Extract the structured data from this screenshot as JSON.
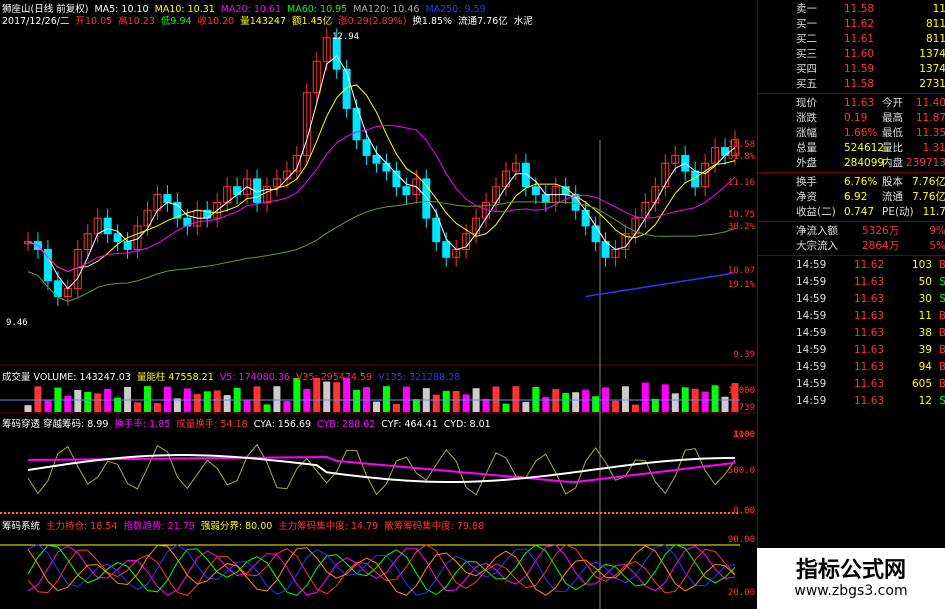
{
  "colors": {
    "up": "#ff3333",
    "down": "#00e5ff",
    "bg": "#000000",
    "grid": "#7a0000",
    "white": "#ffffff",
    "yellow": "#ffff00",
    "green": "#00ff00",
    "magenta": "#ff00ff",
    "purple": "#aa66ff",
    "olive": "#88aa44",
    "blue": "#3333ff"
  },
  "header": {
    "line1": [
      {
        "text": "狮座山(日线 前复权)",
        "color": "#ffffff"
      },
      {
        "text": "MA5: 10.10",
        "color": "#ffffff"
      },
      {
        "text": "MA10: 10.31",
        "color": "#ffff00"
      },
      {
        "text": "MA20: 10.61",
        "color": "#ff00ff"
      },
      {
        "text": "MA60: 10.95",
        "color": "#00ff00"
      },
      {
        "text": "MA120: 10.46",
        "color": "#aaaaaa"
      },
      {
        "text": "MA250: 9.59",
        "color": "#3333ff"
      }
    ],
    "line2": [
      {
        "text": "2017/12/26/二",
        "color": "#ffffff"
      },
      {
        "text": "开10.05",
        "color": "#ff3333"
      },
      {
        "text": "高10.23",
        "color": "#ff3333"
      },
      {
        "text": "低9.94",
        "color": "#00ff00"
      },
      {
        "text": "收10.20",
        "color": "#ff3333"
      },
      {
        "text": "量143247",
        "color": "#ffff00"
      },
      {
        "text": "额1.45亿",
        "color": "#ffff00"
      },
      {
        "text": "涨0.29(2.89%)",
        "color": "#ff3333"
      },
      {
        "text": "换1.85%",
        "color": "#ffffff"
      },
      {
        "text": "流通7.76亿",
        "color": "#ffffff"
      },
      {
        "text": "水泥",
        "color": "#ffffff"
      }
    ]
  },
  "price_axis": [
    "11.58",
    "61.8%",
    "11.16",
    "10.75",
    "38.2%",
    "10.07",
    "19.1%",
    "9.39"
  ],
  "price_annotations": {
    "high": "12.94",
    "low": "9.46"
  },
  "volume_header": [
    {
      "text": "成交量 VOLUME: 143247.03",
      "color": "#ffffff"
    },
    {
      "text": "量能柱 47558.21",
      "color": "#ffff00"
    },
    {
      "text": "V5: 174080.36",
      "color": "#ff00ff"
    },
    {
      "text": "V35: 295474.59",
      "color": "#ff3333"
    },
    {
      "text": "V135: 321288.28",
      "color": "#3333ff"
    }
  ],
  "volume_axis": [
    "10000",
    "4739",
    "X100"
  ],
  "ind1_header": [
    {
      "text": "筹码穿透 穿越筹码: 8.99",
      "color": "#ffffff"
    },
    {
      "text": "换手率: 1.85",
      "color": "#ff00ff"
    },
    {
      "text": "成量换手: 54.18",
      "color": "#ff3333"
    },
    {
      "text": "CYA: 156.69",
      "color": "#ffffff"
    },
    {
      "text": "CYB: 288.62",
      "color": "#ff00ff"
    },
    {
      "text": "CYF: 464.41",
      "color": "#ffffff"
    },
    {
      "text": "CYD: 8.01",
      "color": "#ffffff"
    }
  ],
  "ind1_axis": [
    "1000",
    "500.0",
    "0.00"
  ],
  "ind2_header": [
    {
      "text": "筹码系统",
      "color": "#ffffff"
    },
    {
      "text": "主力持仓: 18.54",
      "color": "#ff3333"
    },
    {
      "text": "指数趋势: 21.79",
      "color": "#ff00ff"
    },
    {
      "text": "强弱分界: 80.00",
      "color": "#ffff00"
    },
    {
      "text": "主力筹码集中度: 14.79",
      "color": "#ff3333"
    },
    {
      "text": "散筹筹码集中度: 79.88",
      "color": "#ff3333"
    }
  ],
  "ind2_axis": [
    "90.00",
    "20.00"
  ],
  "order_book": [
    {
      "label": "卖一",
      "price": "11.58",
      "vol": "11"
    },
    {
      "label": "买一",
      "price": "11.62",
      "vol": "811"
    },
    {
      "label": "买二",
      "price": "11.61",
      "vol": "811"
    },
    {
      "label": "买三",
      "price": "11.60",
      "vol": "1374"
    },
    {
      "label": "买四",
      "price": "11.59",
      "vol": "1374"
    },
    {
      "label": "买五",
      "price": "11.58",
      "vol": "2731"
    }
  ],
  "quote": [
    {
      "l1": "现价",
      "v1": "11.63",
      "l2": "今开",
      "v2": "11.40"
    },
    {
      "l1": "涨跌",
      "v1": "0.19",
      "l2": "最高",
      "v2": "11.87"
    },
    {
      "l1": "涨幅",
      "v1": "1.66%",
      "l2": "最低",
      "v2": "11.35"
    },
    {
      "l1": "总量",
      "v1": "524612",
      "l2": "量比",
      "v2": "1.31"
    },
    {
      "l1": "外盘",
      "v1": "284099",
      "l2": "内盘",
      "v2": "239713"
    }
  ],
  "quote2": [
    {
      "l1": "换手",
      "v1": "6.76%",
      "l2": "股本",
      "v2": "7.76亿"
    },
    {
      "l1": "净资",
      "v1": "6.92",
      "l2": "流通",
      "v2": "7.76亿"
    },
    {
      "l1": "收益(二)",
      "v1": "0.747",
      "l2": "PE(动)",
      "v2": "11.7"
    }
  ],
  "flow": [
    {
      "label": "净流入额",
      "value": "5326万",
      "pct": "9%"
    },
    {
      "label": "大宗流入",
      "value": "2864万",
      "pct": "5%"
    }
  ],
  "ticks": [
    {
      "time": "14:59",
      "price": "11.62",
      "vol": "103",
      "bs": "B"
    },
    {
      "time": "14:59",
      "price": "11.63",
      "vol": "50",
      "bs": "S"
    },
    {
      "time": "14:59",
      "price": "11.63",
      "vol": "30",
      "bs": "S"
    },
    {
      "time": "14:59",
      "price": "11.63",
      "vol": "11",
      "bs": "B"
    },
    {
      "time": "14:59",
      "price": "11.63",
      "vol": "38",
      "bs": "B"
    },
    {
      "time": "14:59",
      "price": "11.63",
      "vol": "39",
      "bs": "B"
    },
    {
      "time": "14:59",
      "price": "11.63",
      "vol": "94",
      "bs": "B"
    },
    {
      "time": "14:59",
      "price": "11.63",
      "vol": "605",
      "bs": "B"
    },
    {
      "time": "14:59",
      "price": "11.63",
      "vol": "12",
      "bs": "S"
    }
  ],
  "watermark": {
    "title": "指标公式网",
    "url": "www.zbgs3.com"
  }
}
